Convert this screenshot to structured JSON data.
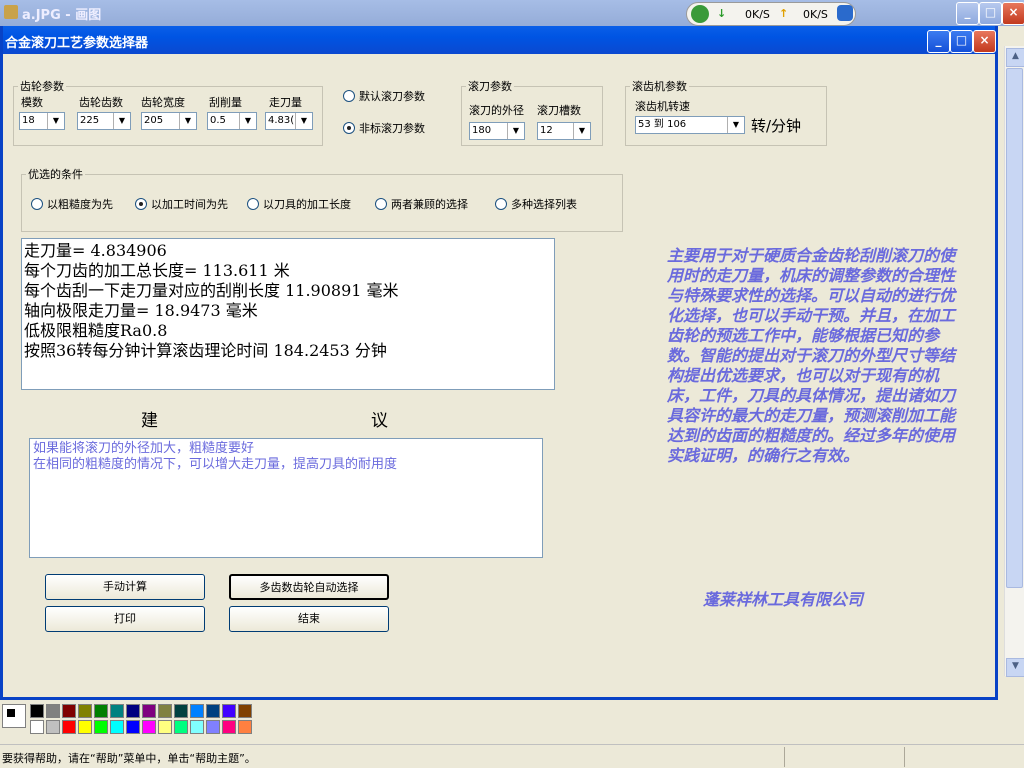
{
  "paint": {
    "title": "a.JPG - 画图",
    "buttons": {
      "minimize": "_",
      "maximize": "□",
      "close": "×"
    }
  },
  "net_tray": {
    "down": "0K/S",
    "up": "0K/S"
  },
  "dialog": {
    "title": "合金滚刀工艺参数选择器",
    "buttons": {
      "minimize": "_",
      "maximize": "□",
      "close": "×"
    }
  },
  "gear_params": {
    "legend": "齿轮参数",
    "fields": [
      {
        "label": "模数",
        "value": "18"
      },
      {
        "label": "齿轮齿数",
        "value": "225"
      },
      {
        "label": "齿轮宽度",
        "value": "205"
      },
      {
        "label": "刮削量",
        "value": "0.5"
      },
      {
        "label": "走刀量",
        "value": "4.83("
      }
    ]
  },
  "hob_mode": {
    "options": [
      {
        "label": "默认滚刀参数",
        "checked": false
      },
      {
        "label": "非标滚刀参数",
        "checked": true
      }
    ]
  },
  "hob_params": {
    "legend": "滚刀参数",
    "fields": [
      {
        "label": "滚刀的外径",
        "value": "180"
      },
      {
        "label": "滚刀槽数",
        "value": "12"
      }
    ]
  },
  "machine_params": {
    "legend": "滚齿机参数",
    "speed_label": "滚齿机转速",
    "speed_value": "53 到 106",
    "unit": "转/分钟"
  },
  "preference": {
    "legend": "优选的条件",
    "options": [
      {
        "label": "以粗糙度为先",
        "checked": false
      },
      {
        "label": "以加工时间为先",
        "checked": true
      },
      {
        "label": "以刀具的加工长度",
        "checked": false
      },
      {
        "label": "两者兼顾的选择",
        "checked": false
      },
      {
        "label": "多种选择列表",
        "checked": false
      }
    ]
  },
  "results": [
    "走刀量= 4.834906",
    "每个刀齿的加工总长度= 113.611 米",
    "每个齿刮一下走刀量对应的刮削长度 11.90891 毫米",
    "轴向极限走刀量= 18.9473 毫米",
    "低极限粗糙度Ra0.8",
    "按照36转每分钟计算滚齿理论时间 184.2453 分钟"
  ],
  "suggest": {
    "heading_left": "建",
    "heading_right": "议",
    "lines": [
      "如果能将滚刀的外径加大，粗糙度要好",
      "在相同的粗糙度的情况下，可以增大走刀量，提高刀具的耐用度"
    ]
  },
  "actions": {
    "manual_calc": "手动计算",
    "multi_select": "多齿数齿轮自动选择",
    "print": "打印",
    "end": "结束"
  },
  "promo": "主要用于对于硬质合金齿轮刮削滚刀的使用时的走刀量，机床的调整参数的合理性与特殊要求性的选择。可以自动的进行优化选择，也可以手动干预。并且，在加工齿轮的预选工作中，能够根据已知的参数。智能的提出对于滚刀的外型尺寸等结构提出优选要求，也可以对于现有的机床，工件，刀具的具体情况，提出诸如刀具容许的最大的走刀量，预测滚削加工能达到的齿面的粗糙度的。经过多年的使用实践证明，的确行之有效。",
  "company": "蓬莱祥林工具有限公司",
  "palette": [
    "#000000",
    "#808080",
    "#800000",
    "#808000",
    "#008000",
    "#008080",
    "#000080",
    "#800080",
    "#808040",
    "#004040",
    "#0080ff",
    "#004080",
    "#4000ff",
    "#804000",
    "#ffffff",
    "#c0c0c0",
    "#ff0000",
    "#ffff00",
    "#00ff00",
    "#00ffff",
    "#0000ff",
    "#ff00ff",
    "#ffff80",
    "#00ff80",
    "#80ffff",
    "#8080ff",
    "#ff0080",
    "#ff8040"
  ],
  "status": "要获得帮助，请在“帮助”菜单中，单击“帮助主题”。"
}
